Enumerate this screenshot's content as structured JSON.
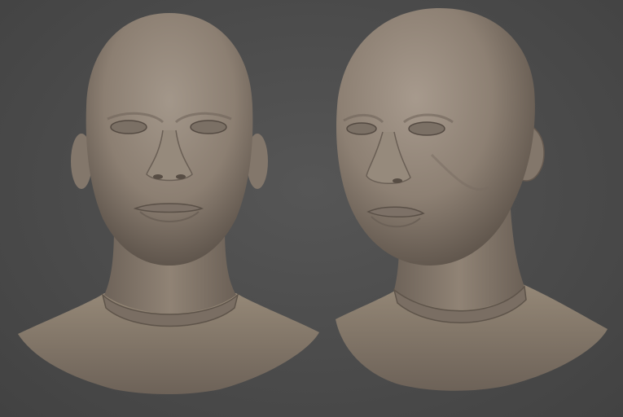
{
  "viewport": {
    "background_color": "#4a4a4a",
    "material_color": "#8e8175",
    "material_highlight": "#a89b8e",
    "material_shadow": "#5a5048",
    "models": [
      {
        "name": "head-sculpt-front",
        "view": "front"
      },
      {
        "name": "head-sculpt-three-quarter",
        "view": "three-quarter"
      }
    ]
  }
}
